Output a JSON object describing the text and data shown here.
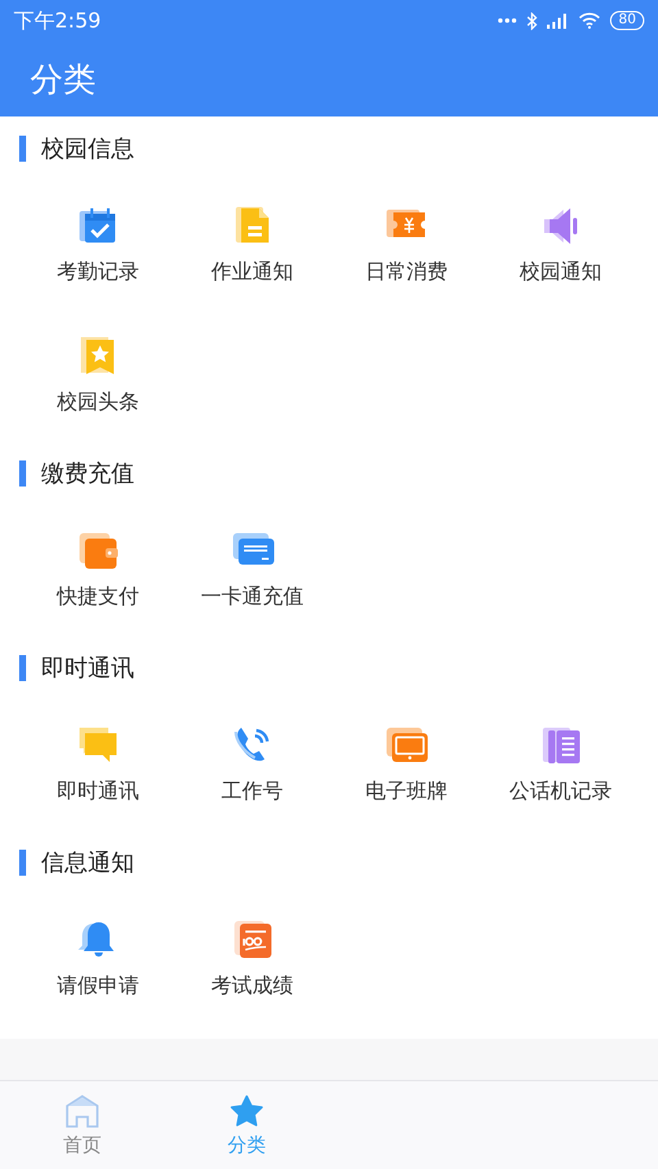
{
  "status_bar": {
    "time": "下午2:59",
    "battery": "80"
  },
  "header": {
    "title": "分类"
  },
  "sections": [
    {
      "title": "校园信息",
      "items": [
        {
          "label": "考勤记录"
        },
        {
          "label": "作业通知"
        },
        {
          "label": "日常消费"
        },
        {
          "label": "校园通知"
        },
        {
          "label": "校园头条"
        }
      ]
    },
    {
      "title": "缴费充值",
      "items": [
        {
          "label": "快捷支付"
        },
        {
          "label": "一卡通充值"
        }
      ]
    },
    {
      "title": "即时通讯",
      "items": [
        {
          "label": "即时通讯"
        },
        {
          "label": "工作号"
        },
        {
          "label": "电子班牌"
        },
        {
          "label": "公话机记录"
        }
      ]
    },
    {
      "title": "信息通知",
      "items": [
        {
          "label": "请假申请"
        },
        {
          "label": "考试成绩"
        }
      ]
    }
  ],
  "tabs": [
    {
      "label": "首页",
      "selected": false
    },
    {
      "label": "分类",
      "selected": true
    }
  ]
}
